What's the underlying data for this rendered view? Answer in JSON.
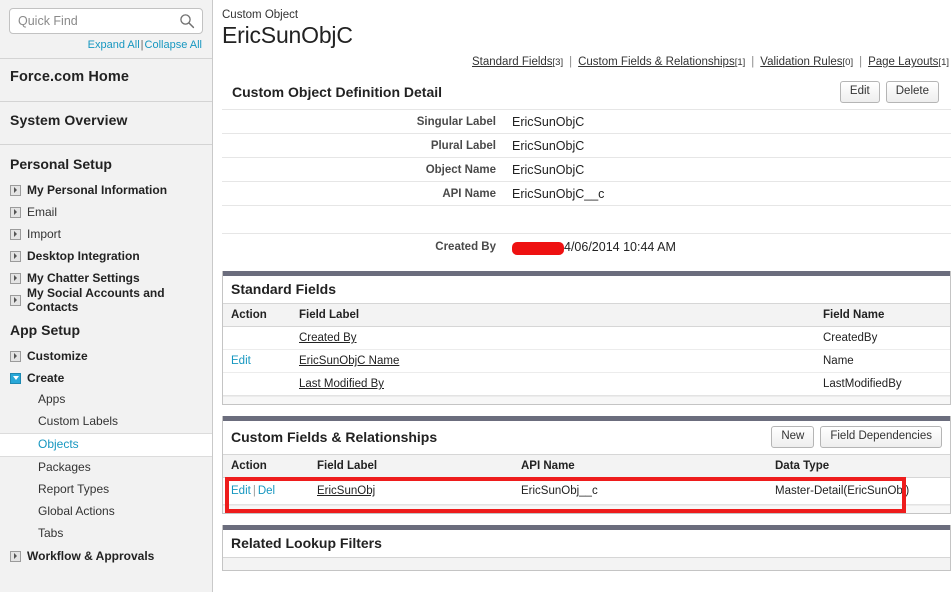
{
  "sidebar": {
    "search": {
      "placeholder": "Quick Find",
      "value": "",
      "icon": "search-icon"
    },
    "expand_all": "Expand All",
    "collapse_all": "Collapse All",
    "separator": "|",
    "home_title": "Force.com Home",
    "system_overview": "System Overview",
    "personal_setup": {
      "title": "Personal Setup",
      "items": [
        {
          "label": "My Personal Information",
          "bold": true,
          "state": "collapsed"
        },
        {
          "label": "Email",
          "bold": false,
          "state": "collapsed"
        },
        {
          "label": "Import",
          "bold": false,
          "state": "collapsed"
        },
        {
          "label": "Desktop Integration",
          "bold": true,
          "state": "collapsed"
        },
        {
          "label": "My Chatter Settings",
          "bold": true,
          "state": "collapsed"
        },
        {
          "label": "My Social Accounts and Contacts",
          "bold": true,
          "state": "collapsed"
        }
      ]
    },
    "app_setup": {
      "title": "App Setup",
      "items": [
        {
          "label": "Customize",
          "bold": true,
          "state": "collapsed"
        },
        {
          "label": "Create",
          "bold": true,
          "state": "expanded"
        }
      ],
      "create_children": [
        {
          "label": "Apps",
          "selected": false
        },
        {
          "label": "Custom Labels",
          "selected": false
        },
        {
          "label": "Objects",
          "selected": true
        },
        {
          "label": "Packages",
          "selected": false
        },
        {
          "label": "Report Types",
          "selected": false
        },
        {
          "label": "Global Actions",
          "selected": false
        },
        {
          "label": "Tabs",
          "selected": false
        }
      ],
      "workflow": {
        "label": "Workflow & Approvals",
        "bold": true,
        "state": "collapsed"
      }
    }
  },
  "header": {
    "breadcrumb": "Custom Object",
    "title": "EricSunObjC",
    "quicklinks": [
      {
        "label": "Standard Fields",
        "count": "[3]"
      },
      {
        "label": "Custom Fields & Relationships",
        "count": "[1]"
      },
      {
        "label": "Validation Rules",
        "count": "[0]"
      },
      {
        "label": "Page Layouts",
        "count": "[1]"
      }
    ],
    "quicklink_separator": "|"
  },
  "detail": {
    "title": "Custom Object Definition Detail",
    "buttons": {
      "edit": "Edit",
      "delete": "Delete"
    },
    "rows": [
      {
        "label": "Singular Label",
        "value": "EricSunObjC"
      },
      {
        "label": "Plural Label",
        "value": "EricSunObjC"
      },
      {
        "label": "Object Name",
        "value": "EricSunObjC"
      },
      {
        "label": "API Name",
        "value": "EricSunObjC__c"
      }
    ],
    "created_by": {
      "label": "Created By",
      "user": "",
      "timestamp": "4/06/2014 10:44 AM"
    }
  },
  "standard_fields": {
    "title": "Standard Fields",
    "columns": [
      "Action",
      "Field Label",
      "Field Name"
    ],
    "rows": [
      {
        "action": "",
        "field_label": "Created By",
        "field_name": "CreatedBy"
      },
      {
        "action": "Edit",
        "field_label": "EricSunObjC Name",
        "field_name": "Name"
      },
      {
        "action": "",
        "field_label": "Last Modified By",
        "field_name": "LastModifiedBy"
      }
    ]
  },
  "custom_fields": {
    "title": "Custom Fields & Relationships",
    "buttons": {
      "new": "New",
      "field_dependencies": "Field Dependencies"
    },
    "columns": [
      "Action",
      "Field Label",
      "API Name",
      "Data Type"
    ],
    "rows": [
      {
        "action_edit": "Edit",
        "action_sep": "|",
        "action_del": "Del",
        "field_label": "EricSunObj",
        "api_name": "EricSunObj__c",
        "data_type": "Master-Detail(EricSunObj)"
      }
    ],
    "highlight_color": "#ee1c1c"
  },
  "related_lookup_filters": {
    "title": "Related Lookup Filters"
  },
  "colors": {
    "link": "#1797c0",
    "panel_bar": "#6b6d7d",
    "redaction": "#ee1111",
    "highlight": "#ee1c1c"
  }
}
